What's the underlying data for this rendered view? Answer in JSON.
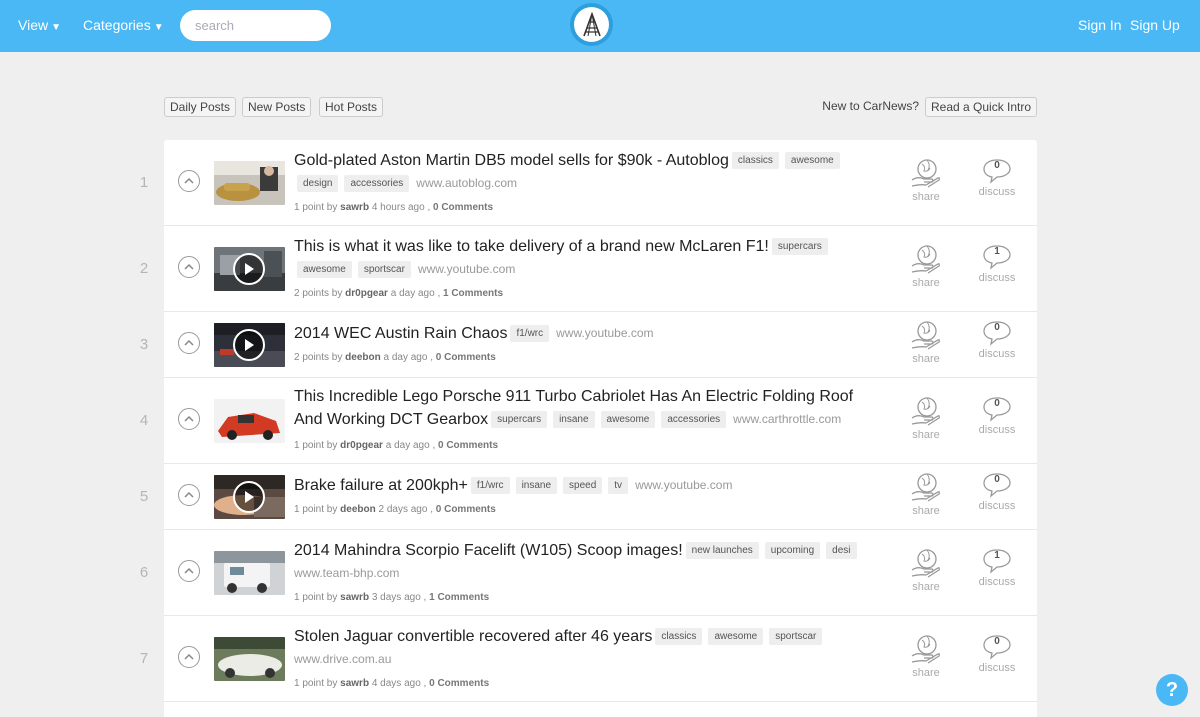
{
  "header": {
    "view_label": "View",
    "categories_label": "Categories",
    "search_placeholder": "search",
    "signin_label": "Sign In",
    "signup_label": "Sign Up"
  },
  "filters": {
    "daily": "Daily Posts",
    "new": "New Posts",
    "hot": "Hot Posts",
    "intro_question": "New to CarNews?",
    "intro_button": "Read a Quick Intro"
  },
  "actions": {
    "share": "share",
    "discuss": "discuss"
  },
  "posts": [
    {
      "rank": "1",
      "title": "Gold-plated Aston Martin DB5 model sells for $90k - Autoblog",
      "tags": [
        "classics",
        "awesome",
        "design",
        "accessories"
      ],
      "domain": "www.autoblog.com",
      "points": "1 point by",
      "author": "sawrb",
      "time": "4 hours ago ,",
      "comments": "0 Comments",
      "comment_count": "0"
    },
    {
      "rank": "2",
      "title": "This is what it was like to take delivery of a brand new McLaren F1!",
      "tags": [
        "supercars",
        "awesome",
        "sportscar"
      ],
      "domain": "www.youtube.com",
      "points": "2 points by",
      "author": "dr0pgear",
      "time": "a day ago ,",
      "comments": "1 Comments",
      "comment_count": "1"
    },
    {
      "rank": "3",
      "title": "2014 WEC Austin Rain Chaos",
      "tags": [
        "f1/wrc"
      ],
      "domain": "www.youtube.com",
      "points": "2 points by",
      "author": "deebon",
      "time": "a day ago ,",
      "comments": "0 Comments",
      "comment_count": "0"
    },
    {
      "rank": "4",
      "title": "This Incredible Lego Porsche 911 Turbo Cabriolet Has An Electric Folding Roof And Working DCT Gearbox",
      "tags": [
        "supercars",
        "insane",
        "awesome",
        "accessories"
      ],
      "domain": "www.carthrottle.com",
      "points": "1 point by",
      "author": "dr0pgear",
      "time": "a day ago ,",
      "comments": "0 Comments",
      "comment_count": "0"
    },
    {
      "rank": "5",
      "title": "Brake failure at 200kph+",
      "tags": [
        "f1/wrc",
        "insane",
        "speed",
        "tv"
      ],
      "domain": "www.youtube.com",
      "points": "1 point by",
      "author": "deebon",
      "time": "2 days ago ,",
      "comments": "0 Comments",
      "comment_count": "0"
    },
    {
      "rank": "6",
      "title": "2014 Mahindra Scorpio Facelift (W105) Scoop images!",
      "tags": [
        "new launches",
        "upcoming",
        "desi"
      ],
      "domain": "www.team-bhp.com",
      "points": "1 point by",
      "author": "sawrb",
      "time": "3 days ago ,",
      "comments": "1 Comments",
      "comment_count": "1"
    },
    {
      "rank": "7",
      "title": "Stolen Jaguar convertible recovered after 46 years",
      "tags": [
        "classics",
        "awesome",
        "sportscar"
      ],
      "domain": "www.drive.com.au",
      "points": "1 point by",
      "author": "sawrb",
      "time": "4 days ago ,",
      "comments": "0 Comments",
      "comment_count": "0"
    }
  ]
}
